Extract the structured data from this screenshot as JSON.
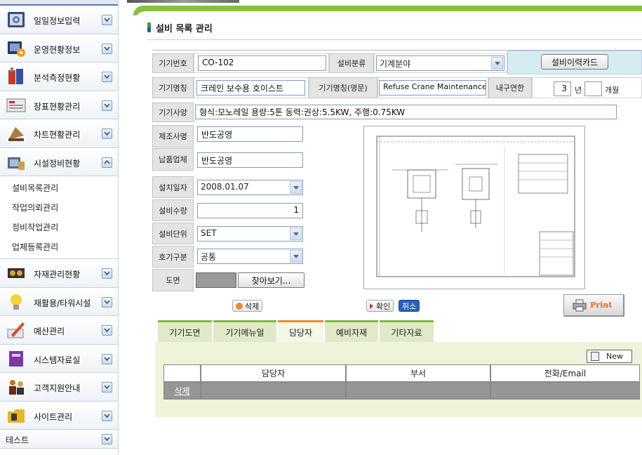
{
  "sidebar": {
    "items": [
      {
        "label": "일일정보입력",
        "icon": "document-gear-icon"
      },
      {
        "label": "운영현황정보",
        "icon": "monitor-gear-icon"
      },
      {
        "label": "분석측정현황",
        "icon": "flask-icon"
      },
      {
        "label": "장표현황관리",
        "icon": "report-sheet-icon"
      },
      {
        "label": "차트현황관리",
        "icon": "chart-hand-icon"
      },
      {
        "label": "시설정비현황",
        "icon": "facility-icon"
      }
    ],
    "submenu": [
      "설비목록관리",
      "작업의뢰관리",
      "정비작업관리",
      "업체등록관리"
    ],
    "items_after": [
      {
        "label": "자재관리현황",
        "icon": "parts-icon"
      },
      {
        "label": "재활용/타워시설",
        "icon": "lightbulb-icon"
      },
      {
        "label": "예산관리",
        "icon": "pencil-icon"
      },
      {
        "label": "시스템자료실",
        "icon": "book-icon"
      },
      {
        "label": "고객지원안내",
        "icon": "people-icon"
      },
      {
        "label": "사이트관리",
        "icon": "folder-icon"
      }
    ],
    "last_item": "테스트"
  },
  "page": {
    "title": "설비 목록 관리"
  },
  "form": {
    "equipment_no_label": "기기번호",
    "equipment_no": "CO-102",
    "category_label": "설비분류",
    "category": "기계분야",
    "history_card_button": "설비이력카드",
    "name_label": "기기명칭",
    "name": "크레인 보수용 호이스트",
    "name_en_label": "기기명칭(영문)",
    "name_en": "Refuse Crane Maintenance",
    "durability_label": "내구연한",
    "durability_years": "3",
    "year_unit": "년",
    "durability_months": "",
    "month_unit": "개월",
    "spec_label": "기기사양",
    "spec": "형식:모노레일 용량:5톤 동력:권상:5.5KW, 주행:0.75KW",
    "maker_label": "제조사명",
    "maker": "반도공영",
    "supplier_label": "납품업체",
    "supplier": "반도공영",
    "install_date_label": "설치일자",
    "install_date": "2008.01.07",
    "quantity_label": "설비수량",
    "quantity": "1",
    "unit_label": "설비단위",
    "unit": "SET",
    "type_label": "호기구분",
    "type": "공통",
    "drawing_label": "도면",
    "browse_button": "찾아보기..."
  },
  "actions": {
    "delete": "삭제",
    "confirm": "확인",
    "cancel": "취소",
    "print": "Print"
  },
  "tabs": [
    {
      "label": "기기도면",
      "active": false
    },
    {
      "label": "기기메뉴얼",
      "active": false
    },
    {
      "label": "담당자",
      "active": true
    },
    {
      "label": "예비자재",
      "active": false
    },
    {
      "label": "기타자료",
      "active": false
    }
  ],
  "grid": {
    "new_button": "New",
    "columns": [
      "",
      "담당자",
      "부서",
      "전화/Email"
    ],
    "rows": [
      {
        "action": "삭제",
        "name": "",
        "dept": "",
        "contact": ""
      }
    ]
  },
  "colors": {
    "accent_green": "#86c140",
    "tab_active_border": "#f08a2a",
    "row_gray": "#969696",
    "cancel_blue": "#2a62b8"
  }
}
